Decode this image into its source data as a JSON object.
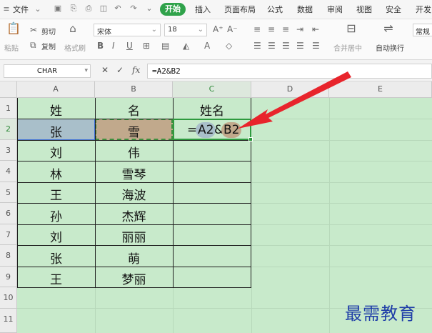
{
  "menu": {
    "file": "文件",
    "tabs": [
      "开始",
      "插入",
      "页面布局",
      "公式",
      "数据",
      "审阅",
      "视图",
      "安全",
      "开发"
    ],
    "active_tab": "开始"
  },
  "ribbon": {
    "paste": "粘贴",
    "cut": "剪切",
    "copy": "复制",
    "format_painter": "格式刷",
    "font_name": "宋体",
    "font_size": "18",
    "merge_center": "合并居中",
    "wrap_text": "自动换行",
    "number_format": "常规"
  },
  "formula_bar": {
    "name_box": "CHAR",
    "formula": "=A2&B2"
  },
  "columns": [
    "A",
    "B",
    "C",
    "D",
    "E"
  ],
  "rows": [
    "1",
    "2",
    "3",
    "4",
    "5",
    "6",
    "7",
    "8",
    "9",
    "10",
    "11"
  ],
  "table": {
    "headers": [
      "姓",
      "名",
      "姓名"
    ],
    "data": [
      [
        "张",
        "雪"
      ],
      [
        "刘",
        "伟"
      ],
      [
        "林",
        "雪琴"
      ],
      [
        "王",
        "海波"
      ],
      [
        "孙",
        "杰辉"
      ],
      [
        "刘",
        "丽丽"
      ],
      [
        "张",
        "萌"
      ],
      [
        "王",
        "梦丽"
      ]
    ]
  },
  "edit_cell": {
    "eq": "=",
    "ref1": "A2",
    "amp": "&",
    "ref2": "B2"
  },
  "watermark": "最需教育",
  "colors": {
    "accent": "#2fa24a",
    "sheet_bg": "#c8eacb",
    "arrow": "#e8242c",
    "a2_highlight": "#a9bfca",
    "b2_highlight": "#c1a98c"
  }
}
